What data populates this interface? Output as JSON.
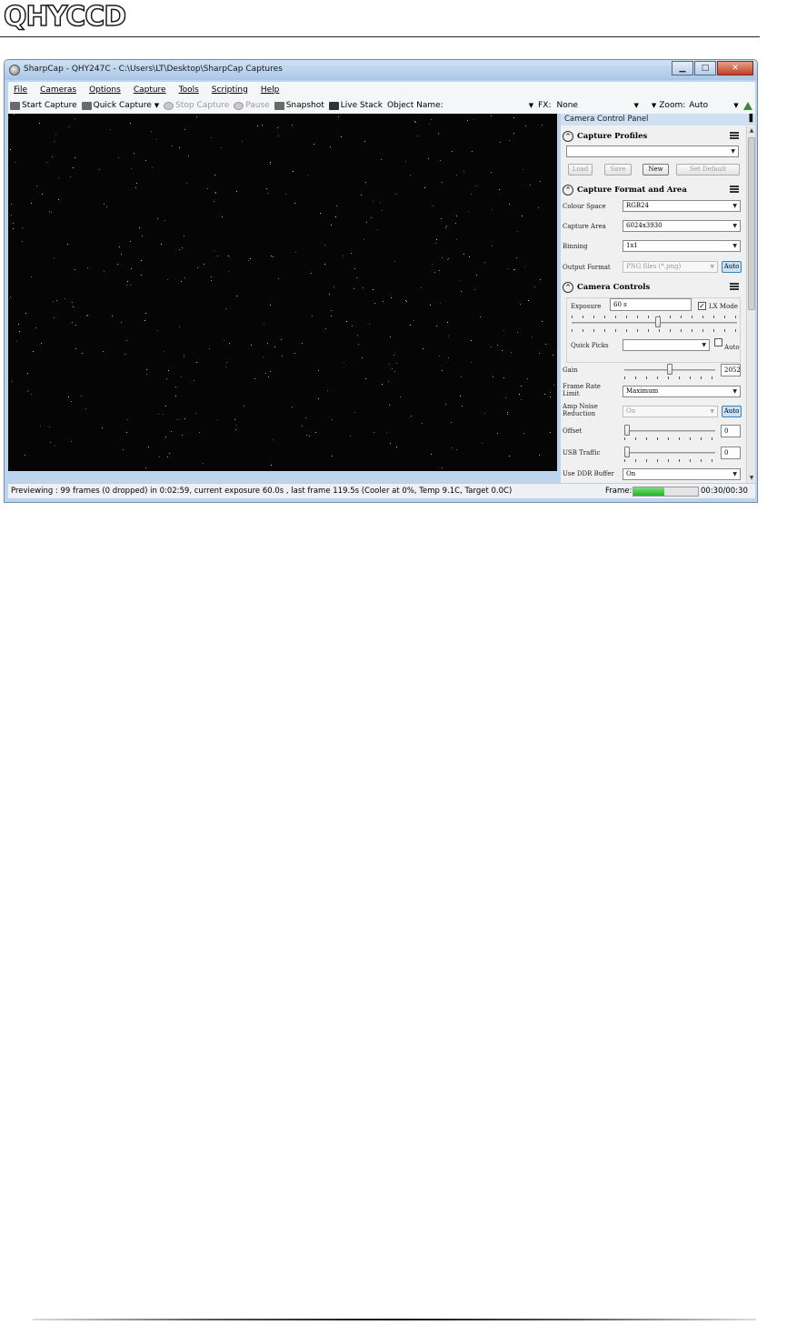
{
  "document": {
    "logo_text": "QHYCCD"
  },
  "window": {
    "title": "SharpCap - QHY247C - C:\\Users\\LT\\Desktop\\SharpCap Captures",
    "buttons": {
      "minimize": "▁",
      "maximize": "□",
      "close": "✕"
    }
  },
  "menu": [
    "File",
    "Cameras",
    "Options",
    "Capture",
    "Tools",
    "Scripting",
    "Help"
  ],
  "toolbar": {
    "start_capture": "Start Capture",
    "quick_capture": "Quick Capture",
    "stop_capture": "Stop Capture",
    "pause": "Pause",
    "snapshot": "Snapshot",
    "live_stack": "Live Stack",
    "object_name_label": "Object Name:",
    "object_name_value": "",
    "fx_label": "FX:",
    "fx_value": "None",
    "zoom_label": "Zoom:",
    "zoom_value": "Auto"
  },
  "panel": {
    "title": "Camera Control Panel",
    "capture_profiles": {
      "title": "Capture Profiles",
      "selected_profile": "",
      "buttons": {
        "load": "Load",
        "save": "Save",
        "new": "New",
        "set_default": "Set Default"
      }
    },
    "capture_format": {
      "title": "Capture Format and Area",
      "colour_space_label": "Colour Space",
      "colour_space_value": "RGB24",
      "capture_area_label": "Capture Area",
      "capture_area_value": "6024x3930",
      "binning_label": "Binning",
      "binning_value": "1x1",
      "output_format_label": "Output Format",
      "output_format_value": "PNG files (*.png)",
      "auto_label": "Auto"
    },
    "camera_controls": {
      "title": "Camera Controls",
      "exposure_label": "Exposure",
      "exposure_value": "60 s",
      "lx_mode_label": "LX Mode",
      "lx_mode_checked": true,
      "quick_picks_label": "Quick Picks",
      "quick_picks_value": "",
      "quick_picks_auto_label": "Auto",
      "exposure_slider_fraction": 0.52,
      "gain_label": "Gain",
      "gain_value": "2052",
      "gain_slider_fraction": 0.5,
      "frame_rate_label": "Frame Rate Limit",
      "frame_rate_value": "Maximum",
      "amp_noise_label": "Amp Noise Reduction",
      "amp_noise_value": "On",
      "amp_auto_label": "Auto",
      "offset_label": "Offset",
      "offset_value": "0",
      "offset_slider_fraction": 0,
      "usb_traffic_label": "USB Traffic",
      "usb_traffic_value": "0",
      "usb_slider_fraction": 0,
      "ddr_buffer_label": "Use DDR Buffer",
      "ddr_buffer_value": "On"
    }
  },
  "status": {
    "text": "Previewing : 99 frames (0 dropped) in 0:02:59, current exposure 60.0s , last frame 119.5s  (Cooler at 0%, Temp 9.1C, Target 0.0C)",
    "frame_label": "Frame:",
    "frame_progress_fraction": 0.48,
    "frame_time": "00:30/00:30"
  },
  "colors": {
    "title_bar": "#bdd4ee",
    "preview_bg": "#050505",
    "progress_green": "#23b223",
    "auto_button": "#c7e2f7"
  }
}
